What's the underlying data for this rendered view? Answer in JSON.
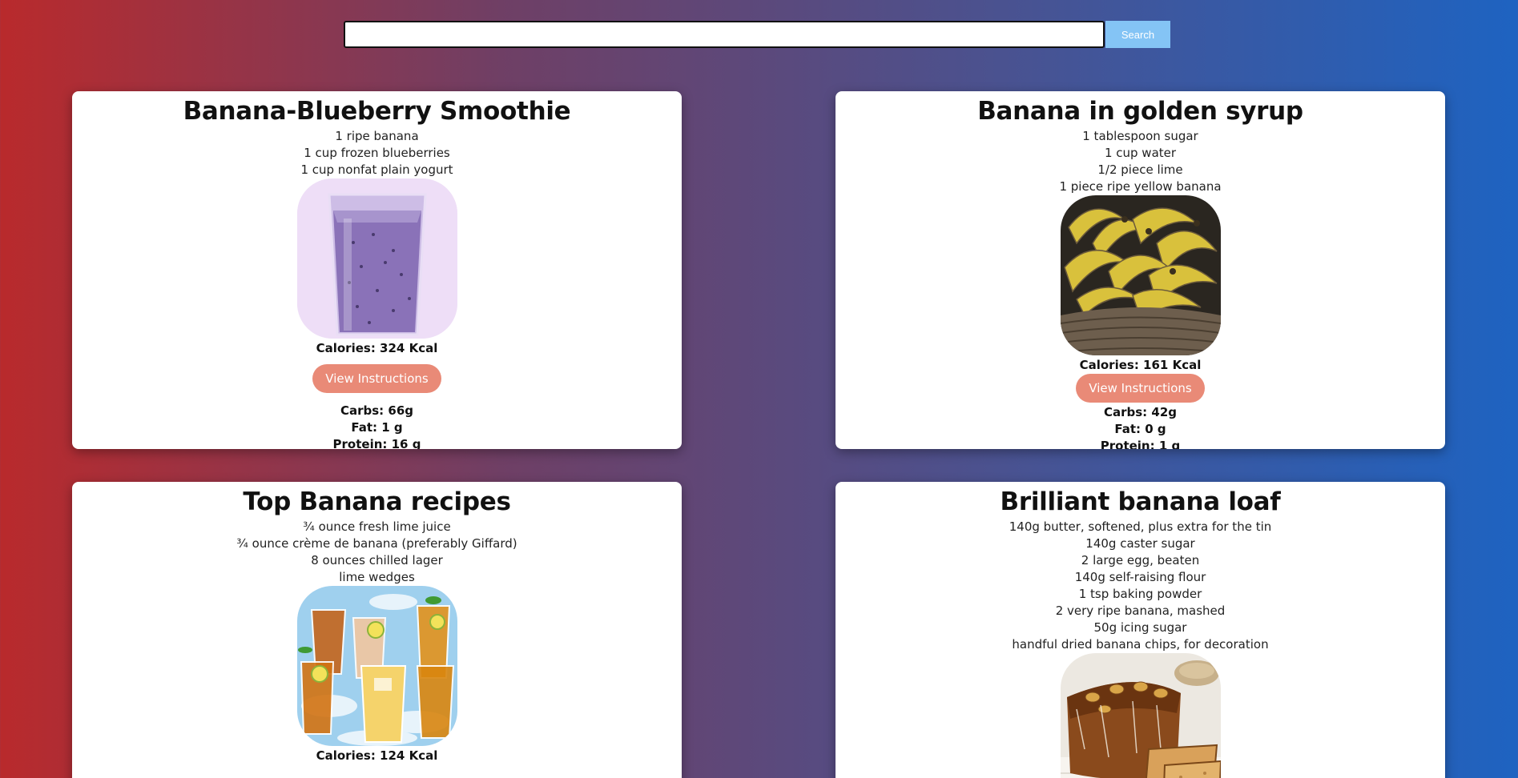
{
  "search": {
    "placeholder": "",
    "value": "",
    "button_label": "Search"
  },
  "recipes": [
    {
      "title": "Banana-Blueberry Smoothie",
      "ingredients": [
        "1 ripe banana",
        "1 cup frozen blueberries",
        "1 cup nonfat plain yogurt"
      ],
      "calories": "Calories: 324 Kcal",
      "button_label": "View Instructions",
      "carbs": "Carbs: 66g",
      "fat": "Fat: 1 g",
      "protein": "Protein: 16 g"
    },
    {
      "title": "Banana in golden syrup",
      "ingredients": [
        "1 tablespoon sugar",
        "1 cup water",
        "1/2 piece lime",
        "1 piece ripe yellow banana"
      ],
      "calories": "Calories: 161 Kcal",
      "button_label": "View Instructions",
      "carbs": "Carbs: 42g",
      "fat": "Fat: 0 g",
      "protein": "Protein: 1 g"
    },
    {
      "title": "Top Banana recipes",
      "ingredients": [
        "¾ ounce fresh lime juice",
        "¾ ounce crème de banana (preferably Giffard)",
        "8 ounces chilled lager",
        "lime wedges"
      ],
      "calories": "Calories: 124 Kcal"
    },
    {
      "title": "Brilliant banana loaf",
      "ingredients": [
        "140g butter, softened, plus extra for the tin",
        "140g caster sugar",
        "2 large egg, beaten",
        "140g self-raising flour",
        "1 tsp baking powder",
        "2 very ripe banana, mashed",
        "50g icing sugar",
        "handful dried banana chips, for decoration"
      ]
    }
  ]
}
